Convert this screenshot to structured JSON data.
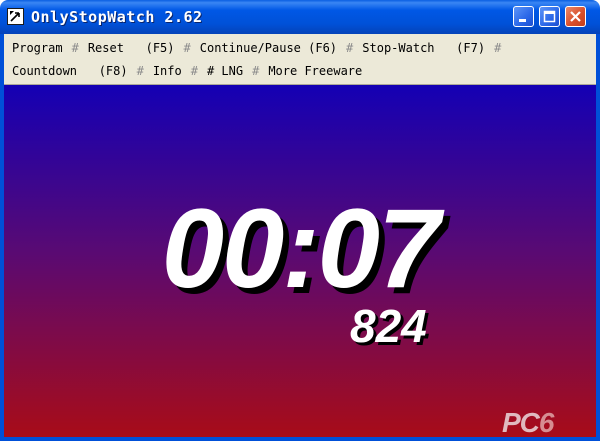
{
  "window": {
    "title": "OnlyStopWatch 2.62",
    "icons": {
      "app": "stopwatch-app-icon",
      "minimize": "minimize-icon",
      "maximize": "maximize-icon",
      "close": "close-icon"
    }
  },
  "menu": {
    "separator": "#",
    "items": [
      "Program",
      "Reset   (F5)",
      "Continue/Pause (F6)",
      "Stop-Watch   (F7)",
      "Countdown   (F8)",
      "Info",
      "# LNG",
      "More Freeware"
    ]
  },
  "display": {
    "time": "00:07",
    "milliseconds": "824",
    "colors": {
      "top": "#1400b4",
      "bottom": "#a80c18",
      "digits": "#ffffff",
      "shadow": "#000000"
    }
  },
  "watermark": {
    "text_a": "PC",
    "text_b": "6"
  }
}
